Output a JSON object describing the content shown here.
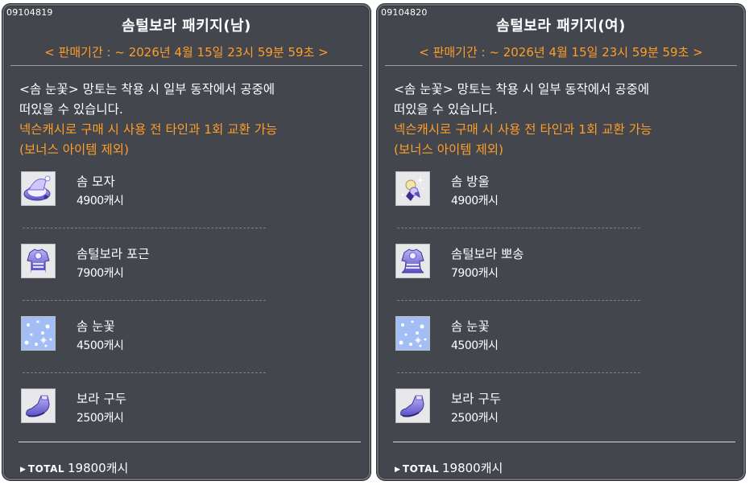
{
  "packages": [
    {
      "code": "09104819",
      "title": "솜털보라 패키지(남)",
      "period": "< 판매기간 : ~ 2026년 4월 15일 23시 59분 59초 >",
      "desc_line1": "<솜 눈꽃> 망토는 착용 시 일부 동작에서 공중에",
      "desc_line2": "떠있을 수 있습니다.",
      "notice_line1": "넥슨캐시로 구매 시 사용 전 타인과 1회 교환 가능",
      "notice_line2": "(보너스 아이템 제외)",
      "items": [
        {
          "name": "솜 모자",
          "price": "4900캐시",
          "icon": "hat-icon"
        },
        {
          "name": "솜털보라 포근",
          "price": "7900캐시",
          "icon": "outfit-icon"
        },
        {
          "name": "솜 눈꽃",
          "price": "4500캐시",
          "icon": "snowflake-cape-icon"
        },
        {
          "name": "보라 구두",
          "price": "2500캐시",
          "icon": "shoe-icon"
        }
      ],
      "total_label": "TOTAL",
      "total_value": "19800캐시"
    },
    {
      "code": "09104820",
      "title": "솜털보라 패키지(여)",
      "period": "< 판매기간 : ~ 2026년 4월 15일 23시 59분 59초 >",
      "desc_line1": "<솜 눈꽃> 망토는 착용 시 일부 동작에서 공중에",
      "desc_line2": "떠있을 수 있습니다.",
      "notice_line1": "넥슨캐시로 구매 시 사용 전 타인과 1회 교환 가능",
      "notice_line2": "(보너스 아이템 제외)",
      "items": [
        {
          "name": "솜 방울",
          "price": "4900캐시",
          "icon": "hair-ornament-icon"
        },
        {
          "name": "솜털보라 뽀송",
          "price": "7900캐시",
          "icon": "outfit-icon"
        },
        {
          "name": "솜 눈꽃",
          "price": "4500캐시",
          "icon": "snowflake-cape-icon"
        },
        {
          "name": "보라 구두",
          "price": "2500캐시",
          "icon": "shoe-icon"
        }
      ],
      "total_label": "TOTAL",
      "total_value": "19800캐시"
    }
  ],
  "colors": {
    "panel_bg": "#43464d",
    "accent_orange": "#ff9d29",
    "text": "#ffffff",
    "icon_purple": "#6c5fd8"
  }
}
